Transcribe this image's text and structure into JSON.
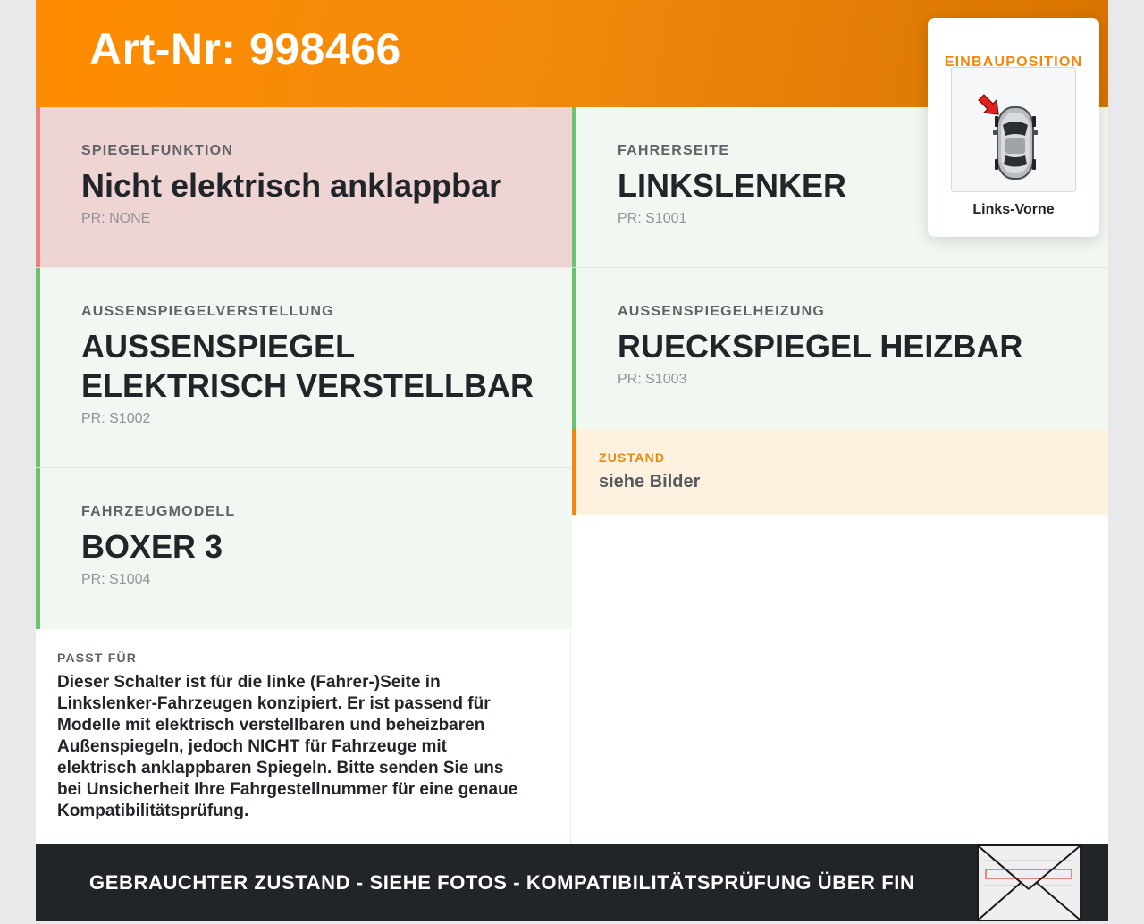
{
  "header": {
    "title": "Art-Nr: 998466"
  },
  "cards": [
    {
      "label": "SPIEGELFUNKTION",
      "value": "Nicht elektrisch anklappbar",
      "pr": "PR: NONE",
      "status": "red"
    },
    {
      "label": "FAHRERSEITE",
      "value": "LINKSLENKER",
      "pr": "PR: S1001",
      "status": "green"
    },
    {
      "label": "AUSSENSPIEGELVERSTELLUNG",
      "value_lines": [
        "AUSSENSPIEGEL",
        "ELEKTRISCH VERSTELLBAR"
      ],
      "pr": "PR: S1002",
      "status": "green"
    },
    {
      "label": "AUSSENSPIEGELHEIZUNG",
      "value": "RUECKSPIEGEL HEIZBAR",
      "pr": "PR: S1003",
      "status": "green"
    },
    {
      "label": "FAHRZEUGMODELL",
      "value": "BOXER 3",
      "pr": "PR: S1004",
      "status": "green"
    }
  ],
  "zustand": {
    "label": "ZUSTAND",
    "value": "siehe Bilder"
  },
  "passt": {
    "label": "PASST FÜR",
    "lines": [
      "Dieser Schalter ist für die linke (Fahrer-)Seite in",
      "Linkslenker-Fahrzeugen konzipiert. Er ist passend für",
      "Modelle mit elektrisch verstellbaren und beheizbaren",
      "Außenspiegeln, jedoch NICHT für Fahrzeuge mit",
      "elektrisch anklappbaren Spiegeln. Bitte senden Sie uns",
      "bei Unsicherheit Ihre Fahrgestellnummer für eine genaue",
      "Kompatibilitätsprüfung."
    ]
  },
  "einbau": {
    "label": "EINBAUPOSITION",
    "position": "Links-Vorne",
    "car_icon": "car-top-view-icon",
    "arrow_icon": "red-arrow-icon"
  },
  "footer": {
    "text": "GEBRAUCHTER ZUSTAND - SIEHE FOTOS - KOMPATIBILITÄTSPRÜFUNG ÜBER FIN"
  },
  "colors": {
    "accent_orange": "#ff8c00",
    "footer_dark": "#212529",
    "status_red": "#f07f7f",
    "status_green": "#6cc36c"
  }
}
